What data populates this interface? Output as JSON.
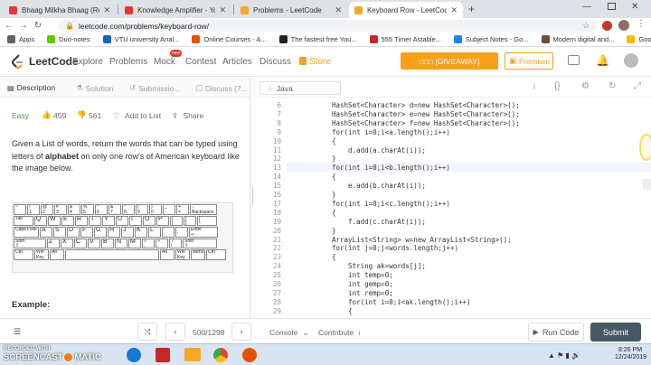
{
  "browser": {
    "tabs": [
      {
        "title": "Bhaag Milkha Bhaag (Rock Versi",
        "color": "#e53935"
      },
      {
        "title": "Knowledge Amplifier - YouTube",
        "color": "#e53935"
      },
      {
        "title": "Problems - LeetCode",
        "color": "#f9a825"
      },
      {
        "title": "Keyboard Row - LeetCode",
        "color": "#f9a825"
      }
    ],
    "new_tab": "+",
    "url": "leetcode.com/problems/keyboard-row/",
    "bookmarks": [
      {
        "label": "Apps",
        "color": "#5f6368"
      },
      {
        "label": "Duo-notes",
        "color": "#58cc02"
      },
      {
        "label": "VTU university Anal...",
        "color": "#1565c0"
      },
      {
        "label": "Online Courses - A...",
        "color": "#e65100"
      },
      {
        "label": "The fastest free You...",
        "color": "#212121"
      },
      {
        "label": "555 Timer Astable...",
        "color": "#c62828"
      },
      {
        "label": "Subject Notes - Go...",
        "color": "#1e88e5"
      },
      {
        "label": "Modern digital and...",
        "color": "#6d4c41"
      },
      {
        "label": "Google Drive",
        "color": "#fbbc04"
      }
    ]
  },
  "lcnav": {
    "brand": "LeetCode",
    "items": [
      "Explore",
      "Problems",
      "Mock",
      "Contest",
      "Articles",
      "Discuss"
    ],
    "new_badge": "new",
    "store": "Store",
    "giveaway": "□□□ [GIVEAWAY]",
    "premium": "Premium"
  },
  "left": {
    "tabs": [
      "Description",
      "Solution",
      "Submissio...",
      "Discuss (7..."
    ],
    "difficulty": "Easy",
    "likes": "459",
    "dislikes": "561",
    "add_to_list": "Add to List",
    "share": "Share",
    "desc_1": "Given a List of words, return the words that can be typed using letters of ",
    "desc_bold": "alphabet",
    "desc_2": " on only one row's of American keyboard like the image below.",
    "example": "Example:"
  },
  "editor": {
    "language": "Java",
    "line_numbers": [
      "6",
      "7",
      "8",
      "9",
      "10",
      "11",
      "12",
      "13",
      "14",
      "15",
      "16",
      "17",
      "18",
      "19",
      "20",
      "21",
      "22",
      "23",
      "24",
      "25",
      "26",
      "27",
      "28",
      "29"
    ],
    "code": [
      "HashSet<Character> d=new HashSet<Character>();",
      "HashSet<Character> e=new HashSet<Character>();",
      "HashSet<Character> f=new HashSet<Character>();",
      "for(int i=0;i<a.length();i++)",
      "{",
      "    d.add(a.charAt(i));",
      "}",
      "for(int i=0;i<b.length();i++)",
      "{",
      "    e.add(b.charAt(i));",
      "}",
      "for(int i=0;i<c.length();i++)",
      "{",
      "    f.add(c.charAt(i));",
      "}",
      "ArrayList<String> w=new ArrayList<String>();",
      "for(int j=0;j<words.length;j++)",
      "{",
      "    String ak=words[j];",
      "    int temp=0;",
      "    int gemp=0;",
      "    int remp=0;",
      "    for(int i=0;i<ak.length();i++)",
      "    {"
    ]
  },
  "bottom": {
    "counter": "500/1298",
    "console": "Console",
    "contribute": "Contribute",
    "run_code": "Run Code",
    "submit": "Submit"
  },
  "taskbar": {
    "watermark_top": "RECORDED WITH",
    "watermark_brand": "SCREENCAST",
    "watermark_suffix": "MATIC",
    "time": "8:26 PM",
    "date": "12/24/2019"
  },
  "colors": {
    "accent": "#f89f1b",
    "easy": "#43a047",
    "submit_bg": "#455a64"
  }
}
